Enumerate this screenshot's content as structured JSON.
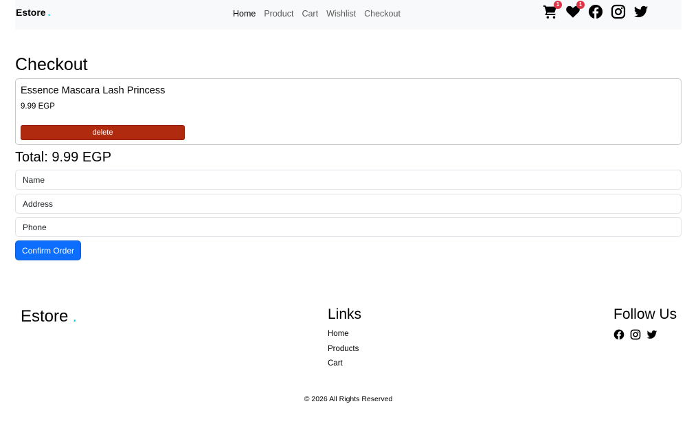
{
  "navbar": {
    "brand": "Estore",
    "brand_dot": ".",
    "links": [
      "Home",
      "Product",
      "Cart",
      "Wishlist",
      "Checkout"
    ],
    "active_link": "Home",
    "cart_count": "1",
    "wishlist_count": "1",
    "icons": [
      "cart-icon",
      "heart-icon",
      "facebook-icon",
      "instagram-icon",
      "twitter-icon"
    ]
  },
  "checkout": {
    "title": "Checkout",
    "items": [
      {
        "name": "Essence Mascara Lash Princess",
        "price": "9.99 EGP",
        "delete_label": "delete"
      }
    ],
    "total": "Total: 9.99 EGP",
    "form": {
      "name_placeholder": "Name",
      "address_placeholder": "Address",
      "phone_placeholder": "Phone",
      "confirm_label": "Confirm Order"
    }
  },
  "footer": {
    "brand": "Estore",
    "brand_dot": ".",
    "links_heading": "Links",
    "links": [
      "Home",
      "Products",
      "Cart"
    ],
    "follow_heading": "Follow Us",
    "social_icons": [
      "facebook-icon",
      "instagram-icon",
      "twitter-icon"
    ],
    "copyright": "© 2026 All Rights Reserved"
  },
  "colors": {
    "accent_dot": "#0dcaf0",
    "badge": "#dc3545",
    "delete_button": "#b02a10",
    "confirm_button": "#0d6efd",
    "navbar_bg": "#f8f9fa"
  }
}
